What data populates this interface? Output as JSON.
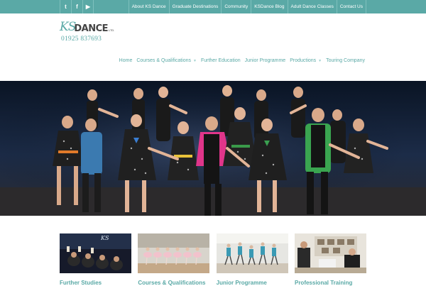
{
  "social": [
    {
      "icon": "twitter-icon",
      "glyph": "t"
    },
    {
      "icon": "facebook-icon",
      "glyph": "f"
    },
    {
      "icon": "youtube-icon",
      "glyph": "▶"
    }
  ],
  "top_nav": [
    "About KS Dance",
    "Graduate Destinations",
    "Community",
    "KSDance Blog",
    "Adult Dance Classes",
    "Contact Us"
  ],
  "logo": {
    "ks": "KS",
    "dance": "DANCE",
    "ltd": "LTD."
  },
  "phone": "01925 837693",
  "main_nav": [
    {
      "label": "Home",
      "dropdown": false
    },
    {
      "label": "Courses & Qualifications",
      "dropdown": true
    },
    {
      "label": "Further Education",
      "dropdown": false
    },
    {
      "label": "Junior Programme",
      "dropdown": false
    },
    {
      "label": "Productions",
      "dropdown": true
    },
    {
      "label": "Touring Company",
      "dropdown": false
    }
  ],
  "thumb_captions": [
    "Further Studies",
    "Courses & Qualifications",
    "Junior Programme",
    "Professional Training"
  ],
  "colors": {
    "accent": "#5aa9a6"
  }
}
